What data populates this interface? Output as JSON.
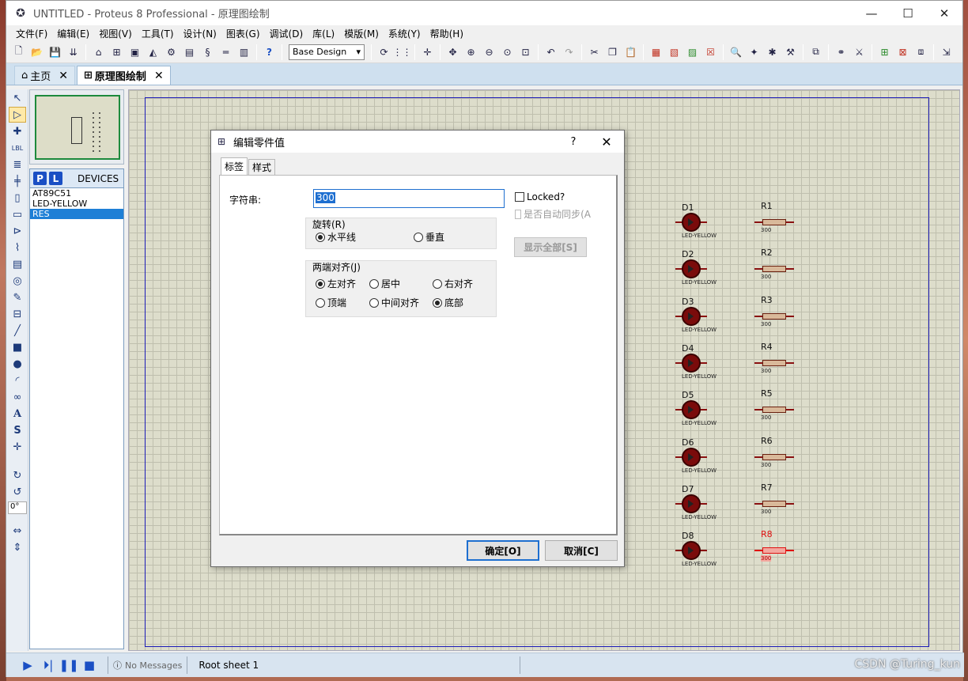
{
  "window": {
    "title": "UNTITLED - Proteus 8 Professional - 原理图绘制",
    "minimize": "—",
    "maximize": "☐",
    "close": "✕"
  },
  "menu": [
    "文件(F)",
    "编辑(E)",
    "视图(V)",
    "工具(T)",
    "设计(N)",
    "图表(G)",
    "调试(D)",
    "库(L)",
    "模版(M)",
    "系统(Y)",
    "帮助(H)"
  ],
  "toolbar": {
    "design_select": "Base Design",
    "icons": [
      "new-icon",
      "open-icon",
      "save-icon",
      "import-icon",
      "home-icon",
      "schematic-icon",
      "pcb-icon",
      "3d-icon",
      "gerber-icon",
      "bom-icon",
      "design-notes-icon",
      "source-icon",
      "help-icon",
      "refresh-icon",
      "grid-icon",
      "origin-icon",
      "pan-icon",
      "zoom-in-icon",
      "zoom-out-icon",
      "zoom-all-icon",
      "zoom-area-icon",
      "undo-icon",
      "redo-icon",
      "cut-icon",
      "copy-icon",
      "paste-icon",
      "block-copy-icon",
      "block-move-icon",
      "block-rotate-icon",
      "block-delete-icon",
      "pick-device-icon",
      "make-device-icon",
      "decompose-icon",
      "packaging-icon",
      "wire-autoroute-icon",
      "search-icon",
      "property-tool-icon",
      "new-sheet-icon",
      "delete-sheet-icon",
      "goto-sheet-icon",
      "export-icon"
    ]
  },
  "tabs": [
    {
      "label": "主页",
      "active": false
    },
    {
      "label": "原理图绘制",
      "active": true
    }
  ],
  "left_tools": {
    "angle": "0°"
  },
  "devices": {
    "p_label": "P",
    "l_label": "L",
    "title": "DEVICES",
    "items": [
      "AT89C51",
      "LED-YELLOW",
      "RES"
    ],
    "selected_index": 2
  },
  "schematic": {
    "leds": [
      {
        "ref": "D1",
        "value": "LED-YELLOW"
      },
      {
        "ref": "D2",
        "value": "LED-YELLOW"
      },
      {
        "ref": "D3",
        "value": "LED-YELLOW"
      },
      {
        "ref": "D4",
        "value": "LED-YELLOW"
      },
      {
        "ref": "D5",
        "value": "LED-YELLOW"
      },
      {
        "ref": "D6",
        "value": "LED-YELLOW"
      },
      {
        "ref": "D7",
        "value": "LED-YELLOW"
      },
      {
        "ref": "D8",
        "value": "LED-YELLOW"
      }
    ],
    "resistors": [
      {
        "ref": "R1",
        "value": "300"
      },
      {
        "ref": "R2",
        "value": "300"
      },
      {
        "ref": "R3",
        "value": "300"
      },
      {
        "ref": "R4",
        "value": "300"
      },
      {
        "ref": "R5",
        "value": "300"
      },
      {
        "ref": "R6",
        "value": "300"
      },
      {
        "ref": "R7",
        "value": "300"
      },
      {
        "ref": "R8",
        "value": "300",
        "highlighted": true
      }
    ]
  },
  "dialog": {
    "title": "编辑零件值",
    "help": "?",
    "close": "✕",
    "tabs": [
      "标签",
      "样式"
    ],
    "string_label": "字符串:",
    "string_value": "300",
    "locked_label": "Locked?",
    "auto_sync_label": "是否自动同步(A",
    "show_all_label": "显示全部[S]",
    "rotation": {
      "title": "旋转(R)",
      "options": [
        "水平线",
        "垂直"
      ],
      "selected": 0
    },
    "justify": {
      "title": "两端对齐(J)",
      "options": [
        "左对齐",
        "居中",
        "右对齐",
        "顶端",
        "中间对齐",
        "底部"
      ],
      "selected_h": 0,
      "selected_v": 5
    },
    "ok_label": "确定[O]",
    "cancel_label": "取消[C]"
  },
  "status": {
    "messages": "No Messages",
    "sheet": "Root sheet 1"
  },
  "watermark": "CSDN @Turing_kun"
}
